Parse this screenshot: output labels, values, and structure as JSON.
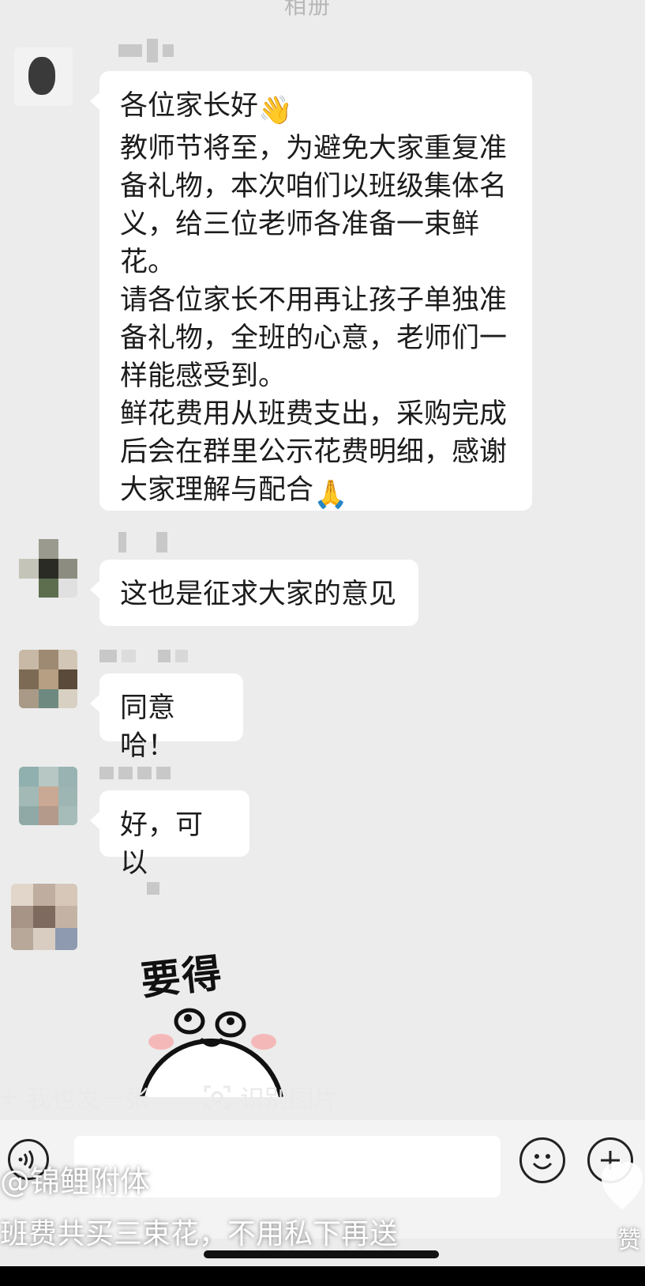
{
  "header": {
    "title": "相册"
  },
  "messages": [
    {
      "lines": [
        "各位家长好",
        "教师节将至，为避免大家重复准",
        "备礼物，本次咱们以班级集体名",
        "义，给三位老师各准备一束鲜",
        "花。",
        "请各位家长不用再让孩子单独准",
        "备礼物，全班的心意，老师们一",
        "样能感受到。",
        "鲜花费用从班费支出，采购完成",
        "后会在群里公示花费明细，感谢",
        "大家理解与配合"
      ],
      "emoji_start": "👋",
      "emoji_end": "🙏"
    },
    {
      "text": "这也是征求大家的意见"
    },
    {
      "text": "同意哈！"
    },
    {
      "text": "好，可以"
    }
  ],
  "sticker": {
    "text": "要得"
  },
  "action_bar": {
    "plus_icon": "plus-icon",
    "forward_label": "我也发一张",
    "recognize_label": "识别图片"
  },
  "input_bar": {
    "voice_icon": "voice-icon",
    "emoji_icon": "emoji-icon",
    "plus_icon": "plus-circle-icon"
  },
  "overlay": {
    "author": "@锦鲤附体",
    "caption": "班费共买三束花，不用私下再送",
    "like_label": "赞"
  },
  "colors": {
    "background": "#ececec",
    "bubble": "#ffffff",
    "input_bar": "#f3f3f3"
  }
}
